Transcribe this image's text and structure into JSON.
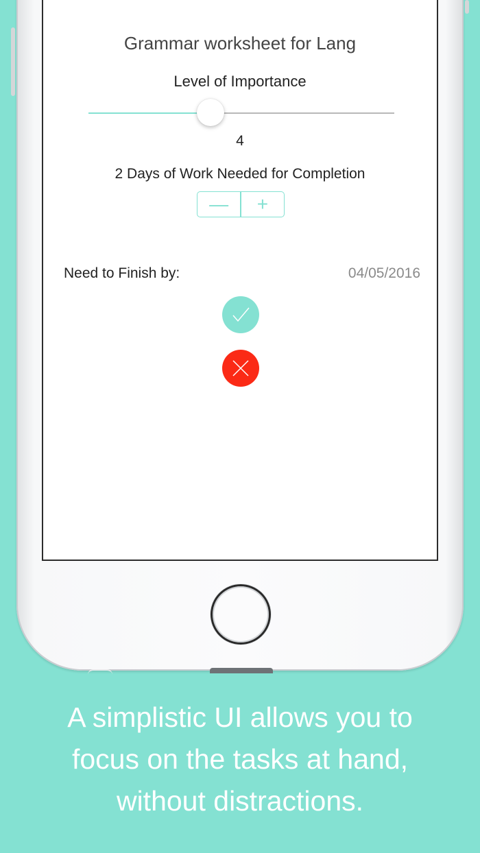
{
  "screen": {
    "task_title": "Grammar worksheet for Lang",
    "importance": {
      "label": "Level of Importance",
      "value": "4",
      "min": 1,
      "max": 10,
      "fraction": 0.4
    },
    "work_days": {
      "label": "2 Days of Work Needed for Completion",
      "decrement_symbol": "—",
      "increment_symbol": "+"
    },
    "deadline": {
      "label": "Need to Finish by:",
      "date": "04/05/2016"
    },
    "actions": {
      "confirm_icon": "checkmark-icon",
      "cancel_icon": "x-icon"
    }
  },
  "caption": {
    "lines": [
      "A simplistic UI allows you to",
      "focus on the tasks at hand,",
      "without distractions."
    ]
  },
  "colors": {
    "background": "#84e1d2",
    "accent": "#84e1d2",
    "danger": "#fb2a16",
    "date_text": "#8a8a8a"
  }
}
